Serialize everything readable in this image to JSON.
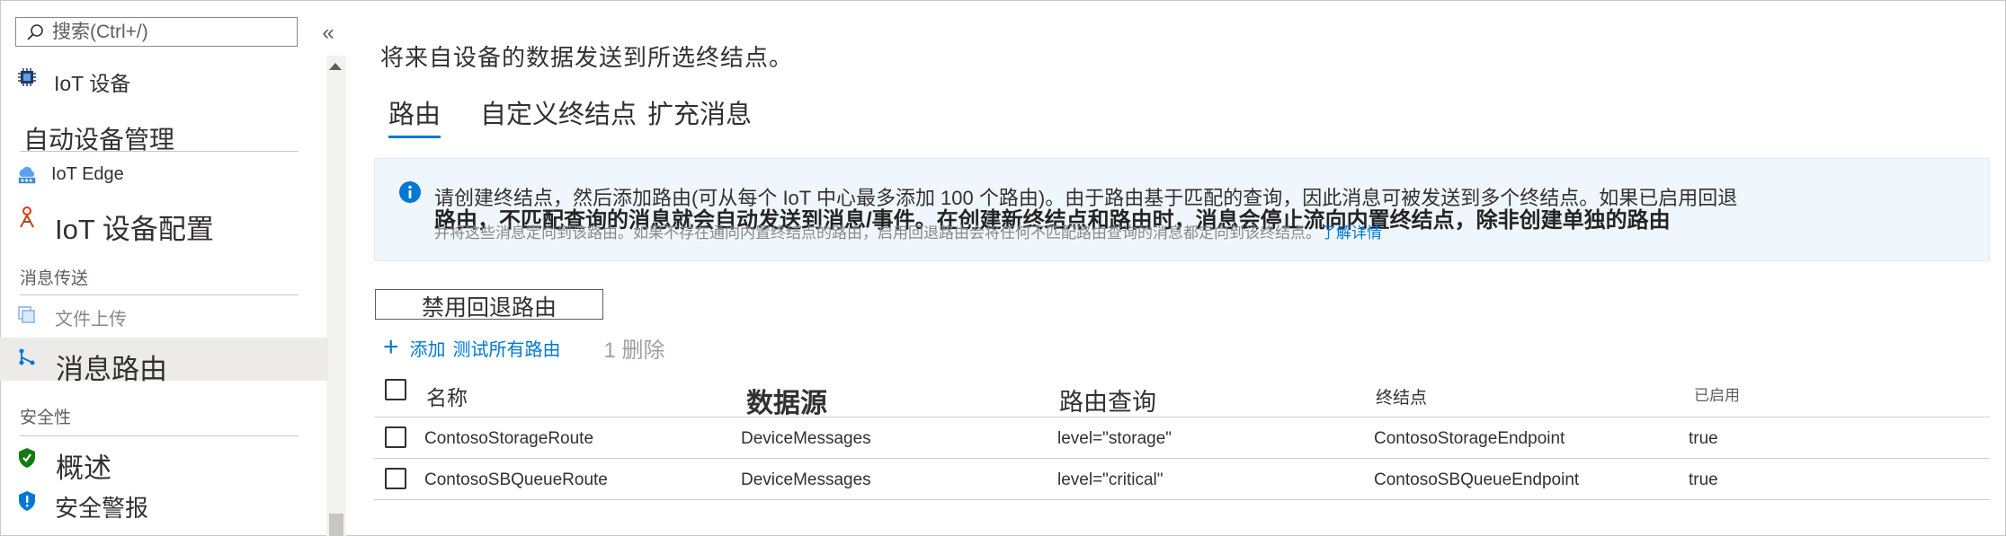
{
  "sidebar": {
    "search_placeholder": "搜索(Ctrl+/)",
    "collapse_glyph": "«",
    "items": [
      {
        "label": "IoT 设备",
        "icon": "chip-icon"
      },
      {
        "label": "IoT Edge",
        "icon": "cloud-edge-icon"
      },
      {
        "label": "IoT 设备配置",
        "icon": "device-config-icon"
      },
      {
        "label": "文件上传",
        "icon": "file-upload-icon"
      },
      {
        "label": "消息路由",
        "icon": "message-routing-icon",
        "selected": true
      },
      {
        "label": "概述",
        "icon": "shield-check-icon"
      },
      {
        "label": "安全警报",
        "icon": "shield-alert-icon"
      }
    ],
    "sections": {
      "auto_device_mgmt": "自动设备管理",
      "messaging": "消息传送",
      "security": "安全性"
    }
  },
  "main": {
    "intro": "将来自设备的数据发送到所选终结点。",
    "tabs": [
      {
        "label": "路由",
        "active": true
      },
      {
        "label": "自定义终结点"
      },
      {
        "label": "扩充消息"
      }
    ],
    "info": {
      "line1": "请创建终结点，然后添加路由(可从每个 IoT 中心最多添加 100 个路由)。由于路由基于匹配的查询，因此消息可被发送到多个终结点。如果已启用回退",
      "line2": "路由，不匹配查询的消息就会自动发送到消息/事件。在创建新终结点和路由时，消息会停止流向内置终结点，除非创建单独的路由",
      "line3": "并将这些消息定向到该路由。如果不存在通向内置终结点的路由，启用回退路由会将任何不匹配路由查询的消息都定向到该终结点。",
      "learn_more": "了解详情"
    },
    "fallback_button": "禁用回退路由",
    "commands": {
      "add": "添加",
      "test": "测试所有路由",
      "delete": "1 删除"
    },
    "table": {
      "columns": [
        "名称",
        "数据源",
        "路由查询",
        "终结点",
        "已启用"
      ],
      "rows": [
        {
          "name": "ContosoStorageRoute",
          "source": "DeviceMessages",
          "query": "level=\"storage\"",
          "endpoint": "ContosoStorageEndpoint",
          "enabled": "true"
        },
        {
          "name": "ContosoSBQueueRoute",
          "source": "DeviceMessages",
          "query": "level=\"critical\"",
          "endpoint": "ContosoSBQueueEndpoint",
          "enabled": "true"
        }
      ]
    }
  },
  "colors": {
    "accent": "#0078d4",
    "info_bg": "#eff6fc",
    "selected_bg": "#edebe9",
    "security_green": "#107c10"
  }
}
